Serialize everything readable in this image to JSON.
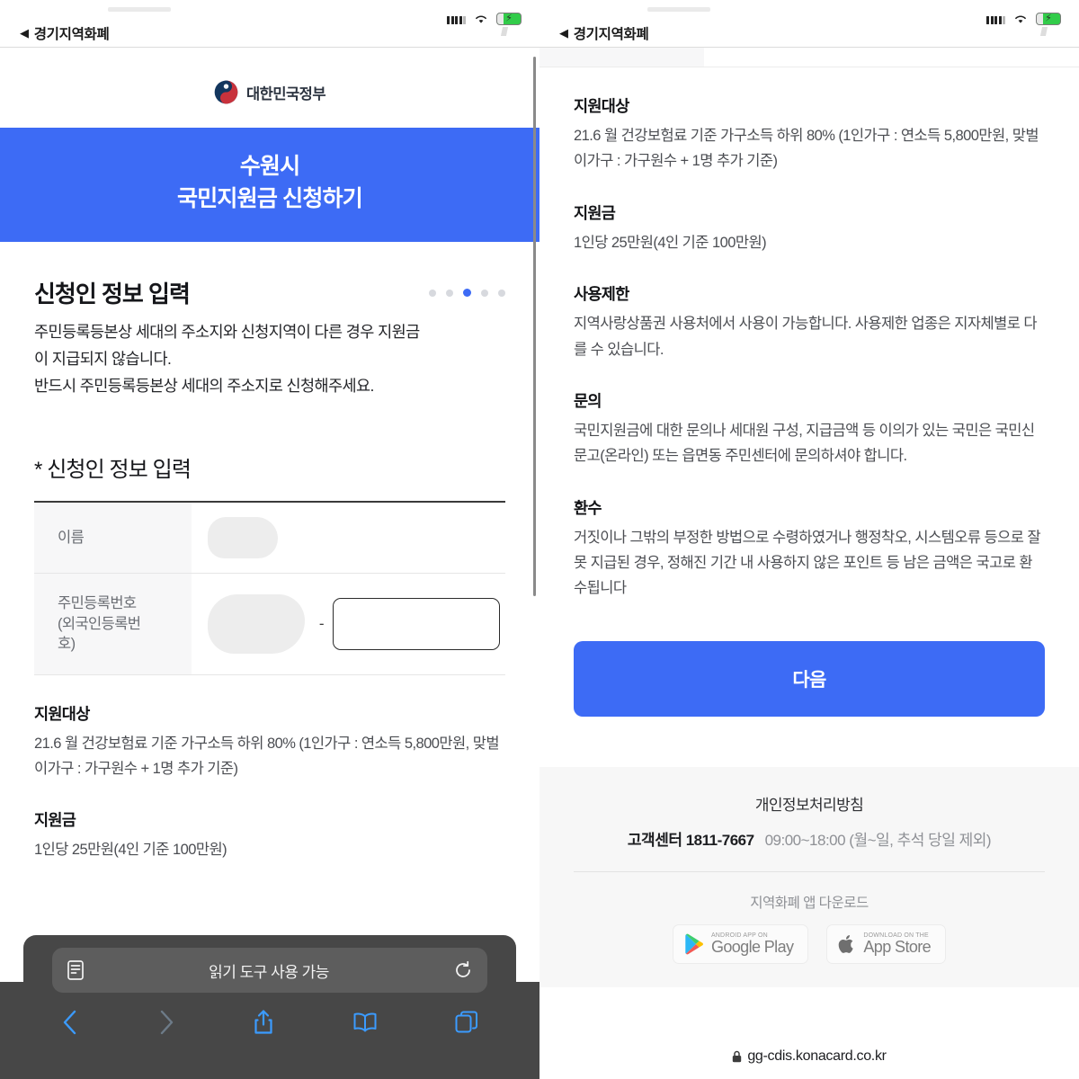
{
  "status_bar": {
    "back_label": "경기지역화폐",
    "back_icon": "triangle-left-icon",
    "signal_icon": "cellular-signal-icon",
    "wifi_icon": "wifi-icon",
    "battery_icon": "battery-charging-icon"
  },
  "brand": {
    "logo_icon": "korea-government-taegeuk-icon",
    "name": "대한민국정부"
  },
  "hero": {
    "line1": "수원시",
    "line2": "국민지원금 신청하기",
    "bg_color": "#3d6bf5"
  },
  "section": {
    "title": "신청인 정보 입력",
    "desc_line1": "주민등록등본상 세대의 주소지와 신청지역이 다른 경우 지원금",
    "desc_line2": "이 지급되지 않습니다.",
    "desc_line3": "반드시 주민등록등본상 세대의 주소지로 신청해주세요.",
    "steps_total": 5,
    "step_active_index": 2,
    "active_color": "#3d6bf5",
    "inactive_color": "#d7d9de"
  },
  "form": {
    "title": "* 신청인 정보 입력",
    "rows": [
      {
        "label": "이름",
        "value": "",
        "redacted": true
      },
      {
        "label": "주민등록번호\n(외국인등록번호)",
        "value": "",
        "redacted": true
      }
    ],
    "rrn_separator": "-",
    "rrn_input_value": "",
    "rrn_input_placeholder": ""
  },
  "info_sections": [
    {
      "heading": "지원대상",
      "body": "21.6 월 건강보험료 기준 가구소득 하위 80% (1인가구 : 연소득 5,800만원, 맞벌이가구 : 가구원수 + 1명 추가 기준)"
    },
    {
      "heading": "지원금",
      "body": "1인당 25만원(4인 기준 100만원)"
    },
    {
      "heading": "사용제한",
      "body": "지역사랑상품권 사용처에서 사용이 가능합니다. 사용제한 업종은 지자체별로 다를 수 있습니다."
    },
    {
      "heading": "문의",
      "body": "국민지원금에 대한 문의나 세대원 구성, 지급금액 등 이의가 있는 국민은 국민신문고(온라인) 또는 읍면동 주민센터에 문의하셔야 합니다."
    },
    {
      "heading": "환수",
      "body": "거짓이나 그밖의 부정한 방법으로 수령하였거나 행정착오, 시스템오류 등으로 잘못 지급된 경우, 정해진 기간 내 사용하지 않은 포인트 등 남은 금액은 국고로 환수됩니다"
    }
  ],
  "next_button": {
    "label": "다음"
  },
  "footer": {
    "privacy_link": "개인정보처리방침",
    "cs_label": "고객센터 1811-7667",
    "cs_hours": "09:00~18:00 (월~일, 추석 당일 제외)",
    "download_label": "지역화폐 앱 다운로드",
    "badges": [
      {
        "small": "ANDROID APP ON",
        "big": "Google Play",
        "icon": "google-play-icon"
      },
      {
        "small": "Download on the",
        "big": "App Store",
        "icon": "apple-logo-icon"
      }
    ]
  },
  "safari_toolbar": {
    "reader_icon": "reader-view-icon",
    "status_label": "읽기 도구 사용 가능",
    "reload_icon": "reload-icon",
    "back_icon": "chevron-left-icon",
    "forward_icon": "chevron-right-icon",
    "share_icon": "share-icon",
    "bookmarks_icon": "book-icon",
    "tabs_icon": "tabs-icon"
  },
  "url_bar": {
    "lock_icon": "lock-icon",
    "url": "gg-cdis.konacard.co.kr"
  }
}
